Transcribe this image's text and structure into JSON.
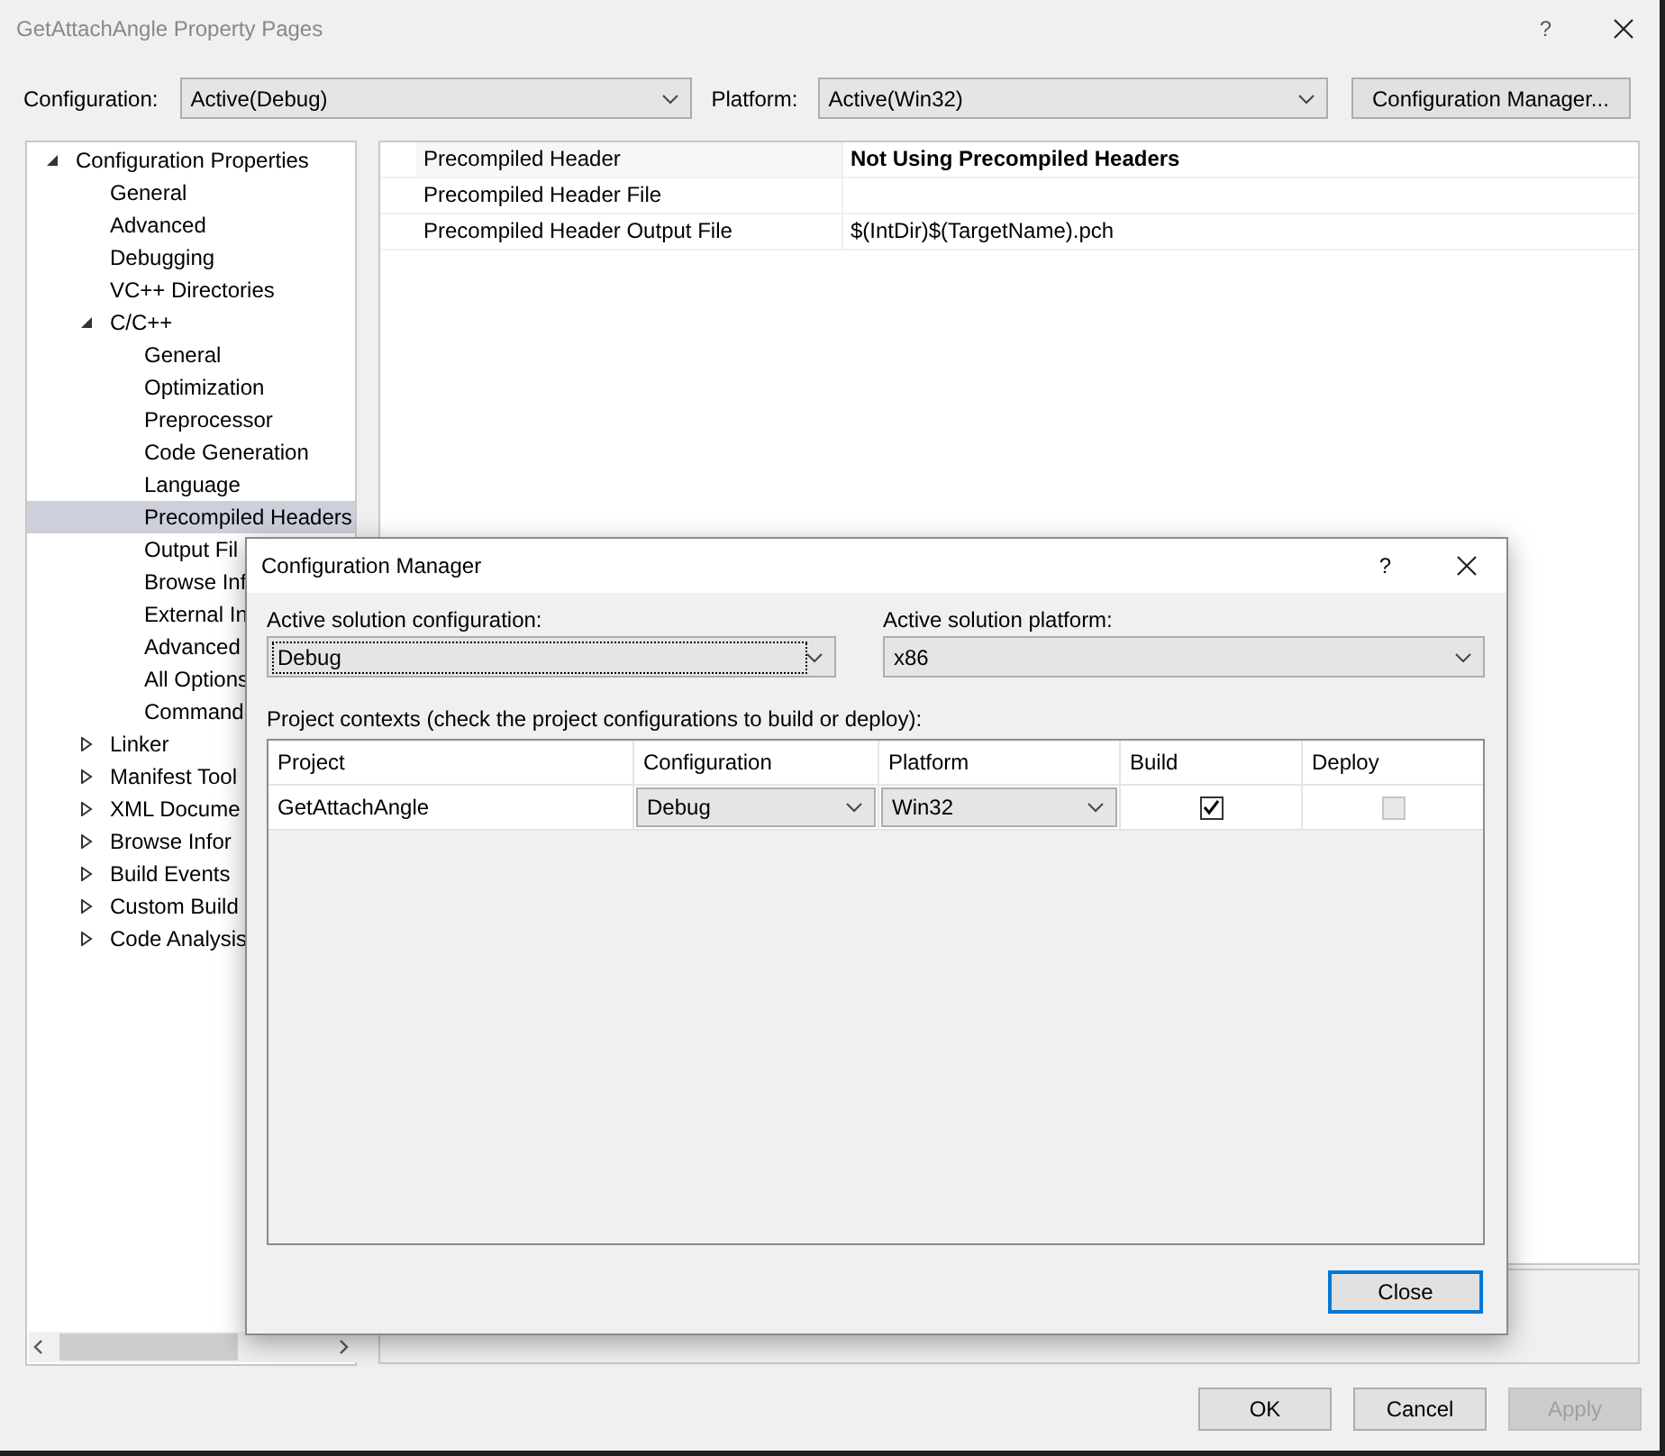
{
  "window": {
    "title": "GetAttachAngle Property Pages",
    "help": "?"
  },
  "config_bar": {
    "configuration_label": "Configuration:",
    "configuration_value": "Active(Debug)",
    "platform_label": "Platform:",
    "platform_value": "Active(Win32)",
    "manager_button": "Configuration Manager..."
  },
  "tree": [
    {
      "label": "Configuration Properties",
      "expanded": true,
      "selected": false,
      "children": [
        {
          "label": "General",
          "selected": false
        },
        {
          "label": "Advanced",
          "selected": false
        },
        {
          "label": "Debugging",
          "selected": false
        },
        {
          "label": "VC++ Directories",
          "selected": false
        },
        {
          "label": "C/C++",
          "expanded": true,
          "selected": false,
          "children": [
            {
              "label": "General",
              "selected": false
            },
            {
              "label": "Optimization",
              "selected": false
            },
            {
              "label": "Preprocessor",
              "selected": false
            },
            {
              "label": "Code Generation",
              "selected": false
            },
            {
              "label": "Language",
              "selected": false
            },
            {
              "label": "Precompiled Headers",
              "selected": true
            },
            {
              "label": "Output Fil",
              "selected": false
            },
            {
              "label": "Browse Inf",
              "selected": false
            },
            {
              "label": "External In",
              "selected": false
            },
            {
              "label": "Advanced",
              "selected": false
            },
            {
              "label": "All Options",
              "selected": false
            },
            {
              "label": "Command",
              "selected": false
            }
          ]
        },
        {
          "label": "Linker",
          "expanded": false,
          "selected": false
        },
        {
          "label": "Manifest Tool",
          "expanded": false,
          "selected": false
        },
        {
          "label": "XML Docume",
          "expanded": false,
          "selected": false
        },
        {
          "label": "Browse Infor",
          "expanded": false,
          "selected": false
        },
        {
          "label": "Build Events",
          "expanded": false,
          "selected": false
        },
        {
          "label": "Custom Build",
          "expanded": false,
          "selected": false
        },
        {
          "label": "Code Analysis",
          "expanded": false,
          "selected": false
        }
      ]
    }
  ],
  "properties": [
    {
      "name": "Precompiled Header",
      "value": "Not Using Precompiled Headers",
      "modified": true
    },
    {
      "name": "Precompiled Header File"
    },
    {
      "name": "Precompiled Header Output File",
      "value": "$(IntDir)$(TargetName).pch",
      "modified": false
    }
  ],
  "buttons": [
    {
      "label": "OK",
      "disabled": false
    },
    {
      "label": "Cancel",
      "disabled": false
    },
    {
      "label": "Apply",
      "disabled": true
    }
  ],
  "dialog": {
    "title": "Configuration Manager",
    "help": "?",
    "active_configuration_label": "Active solution configuration:",
    "active_configuration_value": "Debug",
    "active_platform_label": "Active solution platform:",
    "active_platform_value": "x86",
    "contexts_label": "Project contexts (check the project configurations to build or deploy):",
    "columns": [
      "Project",
      "Configuration",
      "Platform",
      "Build",
      "Deploy"
    ],
    "rows": [
      {
        "project": "GetAttachAngle",
        "configuration": "Debug",
        "platform": "Win32",
        "build": {
          "checked": true,
          "disabled": false
        },
        "deploy": {
          "checked": false,
          "disabled": true
        }
      }
    ],
    "close_button": "Close"
  }
}
